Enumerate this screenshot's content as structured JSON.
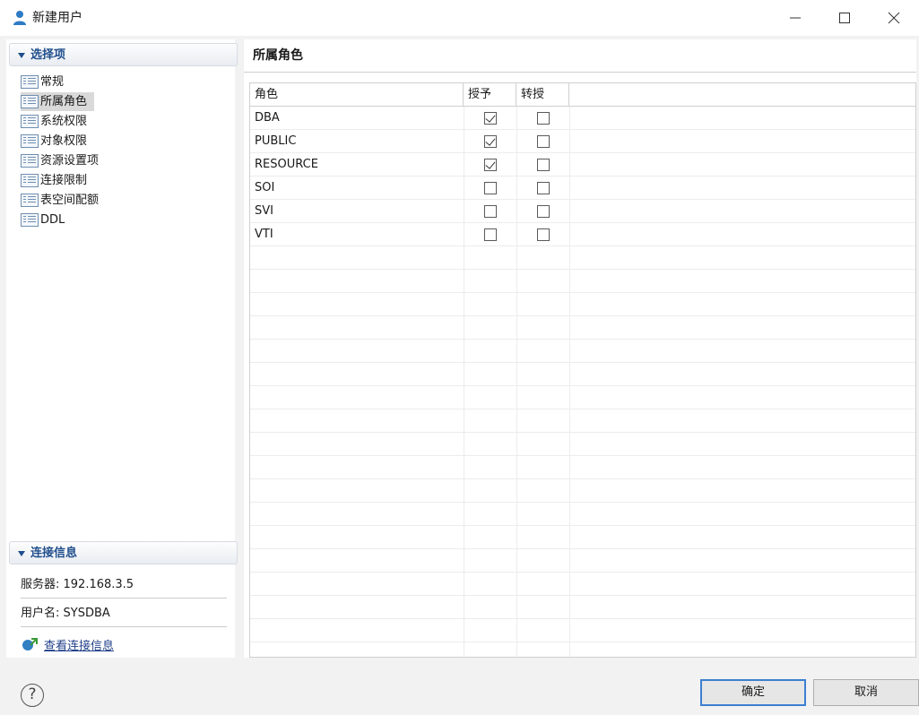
{
  "window": {
    "title": "新建用户"
  },
  "sidebar": {
    "section_title": "选择项",
    "items": [
      {
        "label": "常规"
      },
      {
        "label": "所属角色"
      },
      {
        "label": "系统权限"
      },
      {
        "label": "对象权限"
      },
      {
        "label": "资源设置项"
      },
      {
        "label": "连接限制"
      },
      {
        "label": "表空间配额"
      },
      {
        "label": "DDL"
      }
    ],
    "selected_index": 1
  },
  "connection": {
    "section_title": "连接信息",
    "server": "服务器: 192.168.3.5",
    "user": "用户名: SYSDBA",
    "link": "查看连接信息"
  },
  "panel": {
    "title": "所属角色",
    "columns": [
      "角色",
      "授予",
      "转授"
    ],
    "rows": [
      {
        "role": "DBA",
        "grant": true,
        "delegate": false
      },
      {
        "role": "PUBLIC",
        "grant": true,
        "delegate": false
      },
      {
        "role": "RESOURCE",
        "grant": true,
        "delegate": false
      },
      {
        "role": "SOI",
        "grant": false,
        "delegate": false
      },
      {
        "role": "SVI",
        "grant": false,
        "delegate": false
      },
      {
        "role": "VTI",
        "grant": false,
        "delegate": false
      }
    ]
  },
  "footer": {
    "help_symbol": "?",
    "ok_label": "确定",
    "cancel_label": "取消"
  },
  "colors": {
    "accent": "#1f4e8c",
    "link": "#1f3f8a",
    "focus_border": "#3c7fd1"
  }
}
